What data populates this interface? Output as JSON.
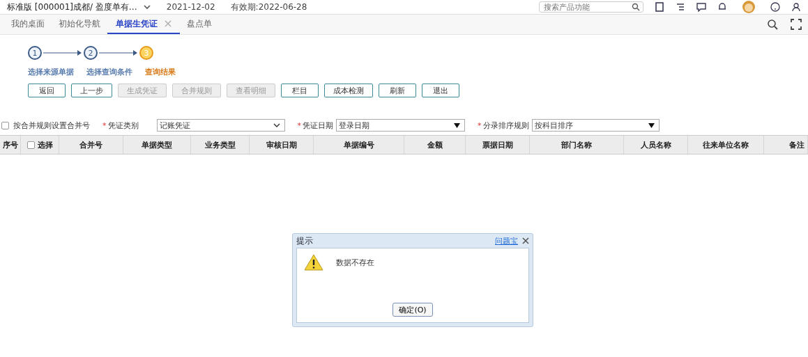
{
  "header": {
    "product": "标准版 [000001]成都/ 盈度单有…",
    "date": "2021-12-02",
    "expiry": "有效期:2022-06-28",
    "search": {
      "placeholder": "搜索产品功能"
    }
  },
  "tabs": [
    {
      "label": "我的桌面",
      "selected": false,
      "closable": false
    },
    {
      "label": "初始化导航",
      "selected": false,
      "closable": false
    },
    {
      "label": "单据生凭证",
      "selected": true,
      "closable": true
    },
    {
      "label": "盘点单",
      "selected": false,
      "closable": false
    }
  ],
  "steps": [
    {
      "number": "1",
      "label": "选择来源单据",
      "current": false
    },
    {
      "number": "2",
      "label": "选择查询条件",
      "current": false
    },
    {
      "number": "3",
      "label": "查询结果",
      "current": true
    }
  ],
  "buttons": [
    {
      "label": "返回",
      "disabled": false
    },
    {
      "label": "上一步",
      "disabled": false
    },
    {
      "label": "生成凭证",
      "disabled": true
    },
    {
      "label": "合并规则",
      "disabled": true
    },
    {
      "label": "查看明细",
      "disabled": true
    },
    {
      "label": "栏目",
      "disabled": false
    },
    {
      "label": "成本检测",
      "disabled": false
    },
    {
      "label": "刷新",
      "disabled": false
    },
    {
      "label": "退出",
      "disabled": false
    }
  ],
  "filters": {
    "required_mark": "*",
    "merge_checkbox": {
      "label": "按合并规则设置合并号",
      "checked": false
    },
    "fields": [
      {
        "label": "凭证类别",
        "value": "记账凭证",
        "required": true,
        "kind": "native"
      },
      {
        "label": "凭证日期",
        "value": "登录日期",
        "required": true,
        "kind": "classic"
      },
      {
        "label": "分录排序规则",
        "value": "按科目排序",
        "required": true,
        "kind": "classic"
      }
    ]
  },
  "table": {
    "columns": [
      {
        "label": "序号",
        "kind": "text"
      },
      {
        "label": "选择",
        "kind": "checkbox",
        "checked": false
      },
      {
        "label": "合并号",
        "kind": "text"
      },
      {
        "label": "单据类型",
        "kind": "text"
      },
      {
        "label": "业务类型",
        "kind": "text"
      },
      {
        "label": "审核日期",
        "kind": "text"
      },
      {
        "label": "单据编号",
        "kind": "text"
      },
      {
        "label": "金额",
        "kind": "text"
      },
      {
        "label": "票据日期",
        "kind": "text"
      },
      {
        "label": "部门名称",
        "kind": "text"
      },
      {
        "label": "人员名称",
        "kind": "text"
      },
      {
        "label": "往来单位名称",
        "kind": "text"
      },
      {
        "label": "备注",
        "kind": "text"
      }
    ]
  },
  "dialog": {
    "title": "提示",
    "help_link": "问题宝",
    "message": "数据不存在",
    "button": "确定(O)"
  }
}
